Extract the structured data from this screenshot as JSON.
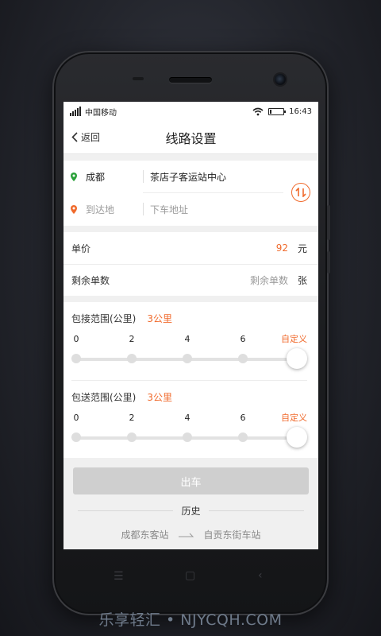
{
  "status_bar": {
    "carrier": "中国移动",
    "time": "16:43",
    "signal_bars": 5,
    "battery_level": 0.15,
    "icons": [
      "signal-icon",
      "wifi-icon",
      "battery-icon"
    ]
  },
  "nav": {
    "back_label": "返回",
    "title": "线路设置"
  },
  "route": {
    "from_city": "成都",
    "from_station": "茶店子客运站中心",
    "to_city_placeholder": "到达地",
    "to_station_placeholder": "下车地址",
    "from_pin_color": "#2aa13a",
    "to_pin_color": "#f06a2c",
    "swap_icon": "swap-icon"
  },
  "pricing": {
    "unit_price_label": "单价",
    "unit_price_value": "92",
    "unit_price_unit": "元",
    "remaining_label": "剩余单数",
    "remaining_placeholder": "剩余单数",
    "remaining_unit": "张"
  },
  "pickup_range": {
    "label": "包接范围(公里)",
    "value": "3公里",
    "custom_label": "自定义",
    "ticks": [
      "0",
      "2",
      "4",
      "6"
    ],
    "selected": "自定义"
  },
  "dropoff_range": {
    "label": "包送范围(公里)",
    "value": "3公里",
    "custom_label": "自定义",
    "ticks": [
      "0",
      "2",
      "4",
      "6"
    ],
    "selected": "自定义"
  },
  "actions": {
    "depart_label": "出车"
  },
  "history": {
    "title": "历史",
    "from": "成都东客站",
    "to": "自贡东街车站"
  },
  "watermark": "乐享轻汇 • NJYCQH.COM",
  "colors": {
    "accent": "#f06a2c",
    "disabled_button": "#cfcfcf",
    "page_bg": "#f0f0f0"
  }
}
